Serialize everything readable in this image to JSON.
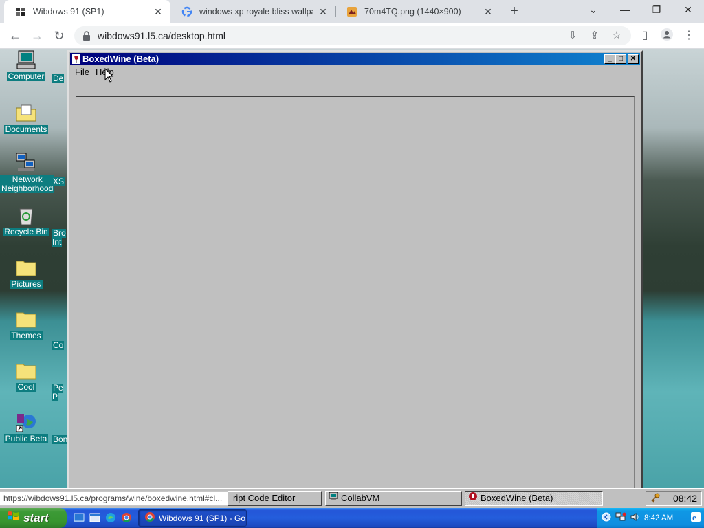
{
  "browser": {
    "tabs": [
      {
        "title": "Wibdows 91 (SP1)",
        "active": true
      },
      {
        "title": "windows xp royale bliss wallpaper",
        "active": false
      },
      {
        "title": "70m4TQ.png (1440×900)",
        "active": false
      }
    ],
    "new_tab": "+",
    "url": "wibdows91.l5.ca/desktop.html",
    "status_url": "https://wibdows91.l5.ca/programs/wine/boxedwine.html#cl..."
  },
  "desktop": {
    "icons": [
      {
        "label": "Computer",
        "icon": "computer-icon"
      },
      {
        "label": "Documents",
        "icon": "documents-folder-icon"
      },
      {
        "label": "Network\nNeighborhood",
        "icon": "network-neighborhood-icon"
      },
      {
        "label": "Recycle Bin",
        "icon": "recycle-bin-icon"
      },
      {
        "label": "Pictures",
        "icon": "folder-icon"
      },
      {
        "label": "Themes",
        "icon": "folder-icon"
      },
      {
        "label": "Cool",
        "icon": "folder-icon"
      },
      {
        "label": "Public Beta",
        "icon": "globe-shortcut-icon"
      }
    ],
    "second_column": [
      "De",
      "XS",
      "Bro\nInt",
      "Co",
      "Pe\nP",
      "Bon"
    ]
  },
  "window": {
    "title": "BoxedWine (Beta)",
    "menu": [
      "File",
      "Help"
    ]
  },
  "w95_taskbar": {
    "buttons": [
      {
        "label": "ript Code Editor"
      },
      {
        "label": "CollabVM"
      },
      {
        "label": "BoxedWine (Beta)"
      }
    ],
    "clock": "08:42"
  },
  "xp_taskbar": {
    "start": "start",
    "task": "Wibdows 91 (SP1) - Go...",
    "clock": "8:42 AM"
  }
}
